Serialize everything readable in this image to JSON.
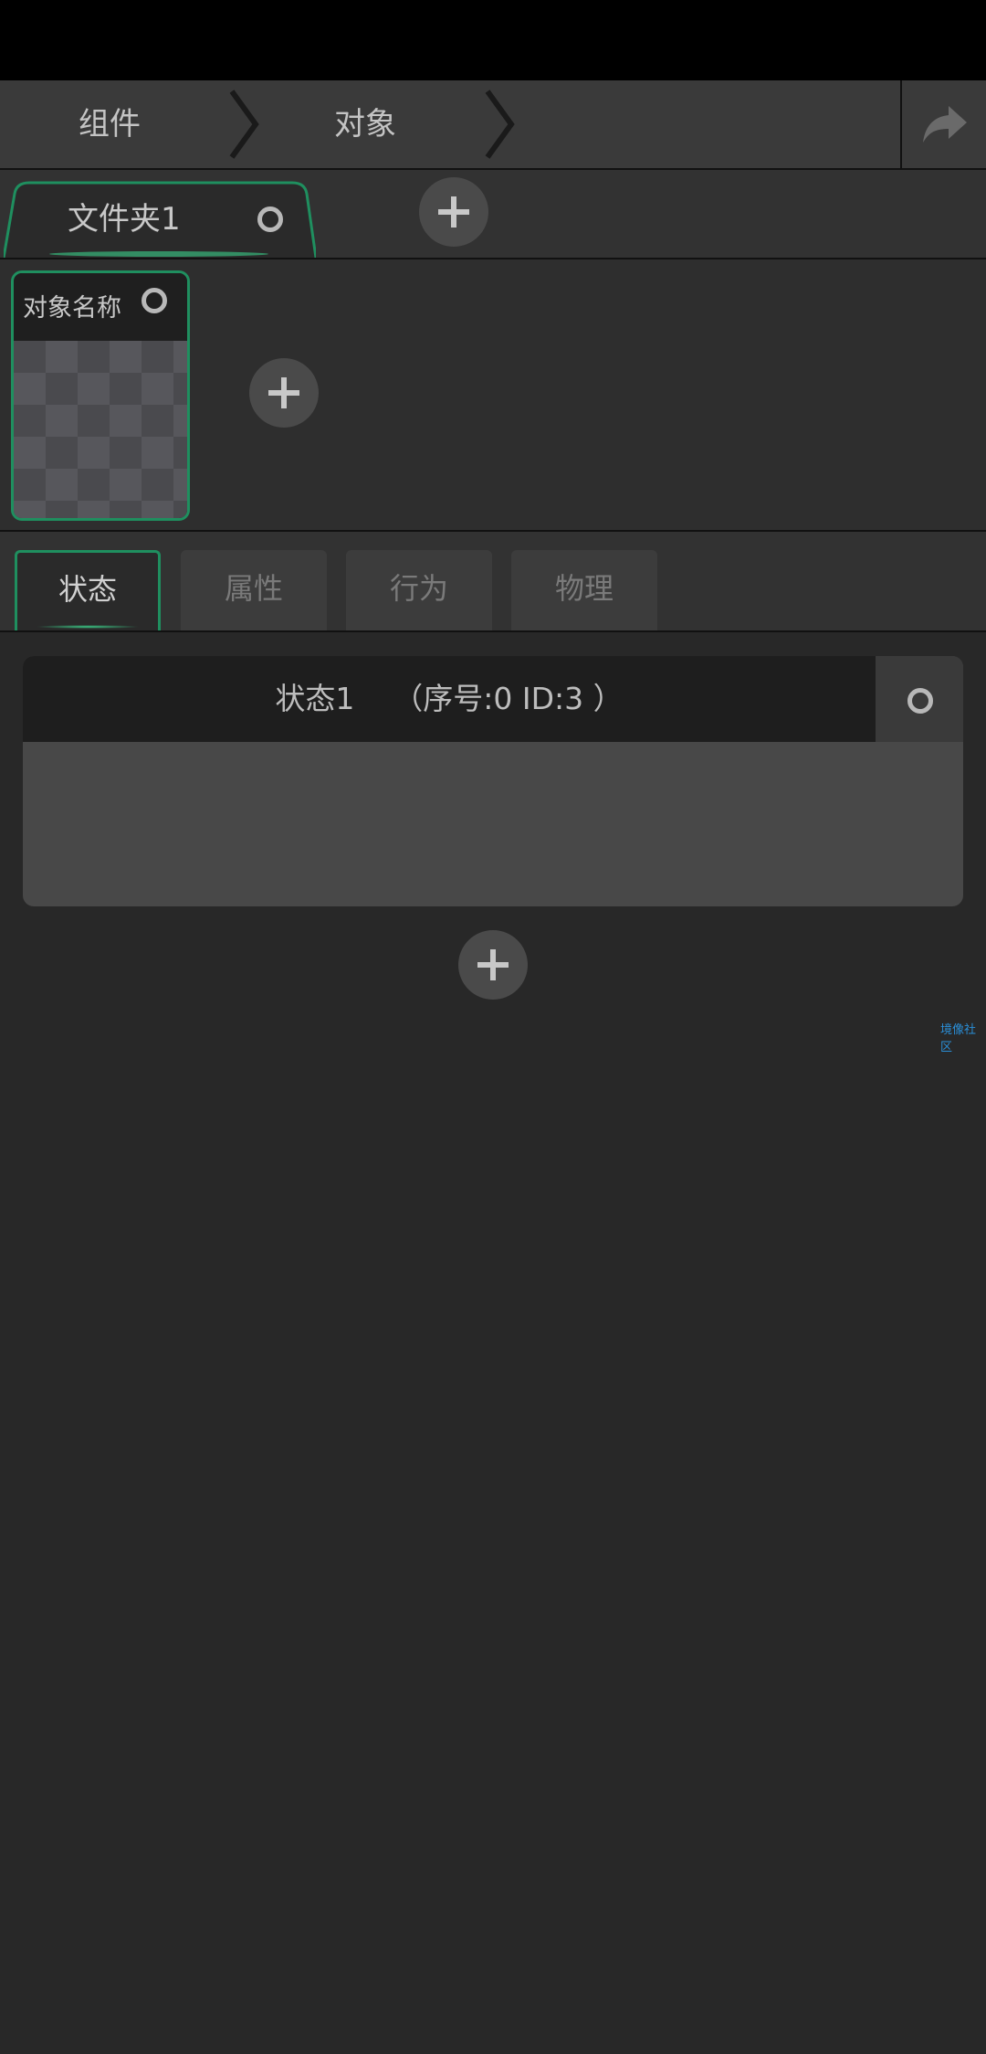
{
  "breadcrumb": {
    "items": [
      "组件",
      "对象"
    ],
    "share_icon": "share-arrow-icon"
  },
  "folders": {
    "items": [
      {
        "label": "文件夹1"
      }
    ],
    "add_icon": "plus-icon"
  },
  "objects": {
    "items": [
      {
        "name": "对象名称"
      }
    ],
    "add_icon": "plus-icon"
  },
  "tabs": {
    "items": [
      {
        "label": "状态",
        "active": true
      },
      {
        "label": "属性",
        "active": false
      },
      {
        "label": "行为",
        "active": false
      },
      {
        "label": "物理",
        "active": false
      }
    ]
  },
  "states": {
    "items": [
      {
        "title": "状态1    （序号:0 ID:3 ）"
      }
    ],
    "add_icon": "plus-icon"
  },
  "watermark": "境像社区",
  "colors": {
    "accent": "#1f8f5f",
    "background": "#282828",
    "panel": "#484848"
  }
}
